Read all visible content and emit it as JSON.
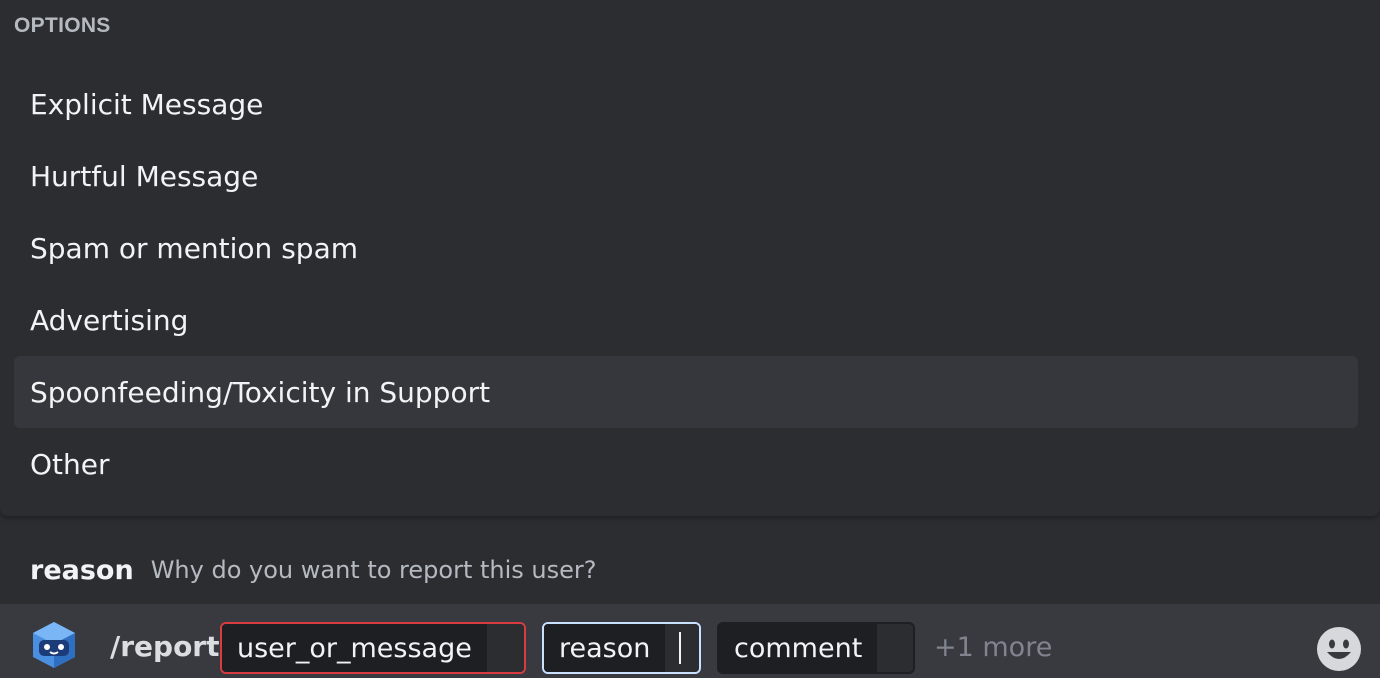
{
  "popup": {
    "header": "OPTIONS",
    "options": [
      {
        "label": "Explicit Message"
      },
      {
        "label": "Hurtful Message"
      },
      {
        "label": "Spam or mention spam"
      },
      {
        "label": "Advertising"
      },
      {
        "label": "Spoonfeeding/Toxicity in Support",
        "selected": true
      },
      {
        "label": "Other"
      }
    ]
  },
  "hint": {
    "param_name": "reason",
    "param_description": "Why do you want to report this user?"
  },
  "composer": {
    "command": "/report",
    "params": [
      {
        "label": "user_or_message",
        "state": "error"
      },
      {
        "label": "reason",
        "state": "active"
      },
      {
        "label": "comment",
        "state": "normal"
      }
    ],
    "more_label": "+1 more"
  },
  "icons": {
    "bot_avatar": "bot-cube-icon",
    "emoji": "smiley-emoji-icon"
  },
  "colors": {
    "background": "#2b2d31",
    "composer": "#383a40",
    "selected_option": "#35373c",
    "error_border": "#d83c3e",
    "active_border": "#c9e1ff",
    "muted_text": "#b5bac1"
  }
}
